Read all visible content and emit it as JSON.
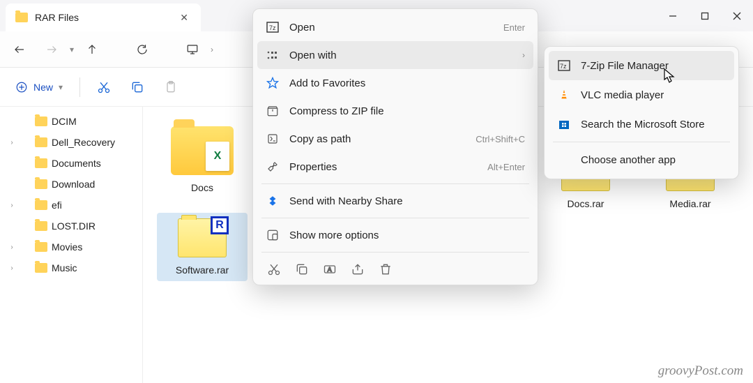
{
  "titlebar": {
    "tab_title": "RAR Files"
  },
  "cmdbar": {
    "new_label": "New"
  },
  "tree": {
    "items": [
      {
        "label": "DCIM",
        "expandable": false
      },
      {
        "label": "Dell_Recovery",
        "expandable": true
      },
      {
        "label": "Documents",
        "expandable": false
      },
      {
        "label": "Download",
        "expandable": false
      },
      {
        "label": "efi",
        "expandable": true
      },
      {
        "label": "LOST.DIR",
        "expandable": false
      },
      {
        "label": "Movies",
        "expandable": true
      },
      {
        "label": "Music",
        "expandable": true
      }
    ]
  },
  "content": {
    "folder_label": "Docs",
    "selected_label": "Software.rar",
    "right_files": [
      "Docs.rar",
      "Media.rar"
    ]
  },
  "ctx": {
    "open": "Open",
    "open_sc": "Enter",
    "open_with": "Open with",
    "favorites": "Add to Favorites",
    "compress": "Compress to ZIP file",
    "copy_path": "Copy as path",
    "copy_path_sc": "Ctrl+Shift+C",
    "properties": "Properties",
    "properties_sc": "Alt+Enter",
    "nearby": "Send with Nearby Share",
    "more": "Show more options"
  },
  "submenu": {
    "seven_zip": "7-Zip File Manager",
    "vlc": "VLC media player",
    "store": "Search the Microsoft Store",
    "another": "Choose another app"
  },
  "watermark": "groovyPost.com"
}
